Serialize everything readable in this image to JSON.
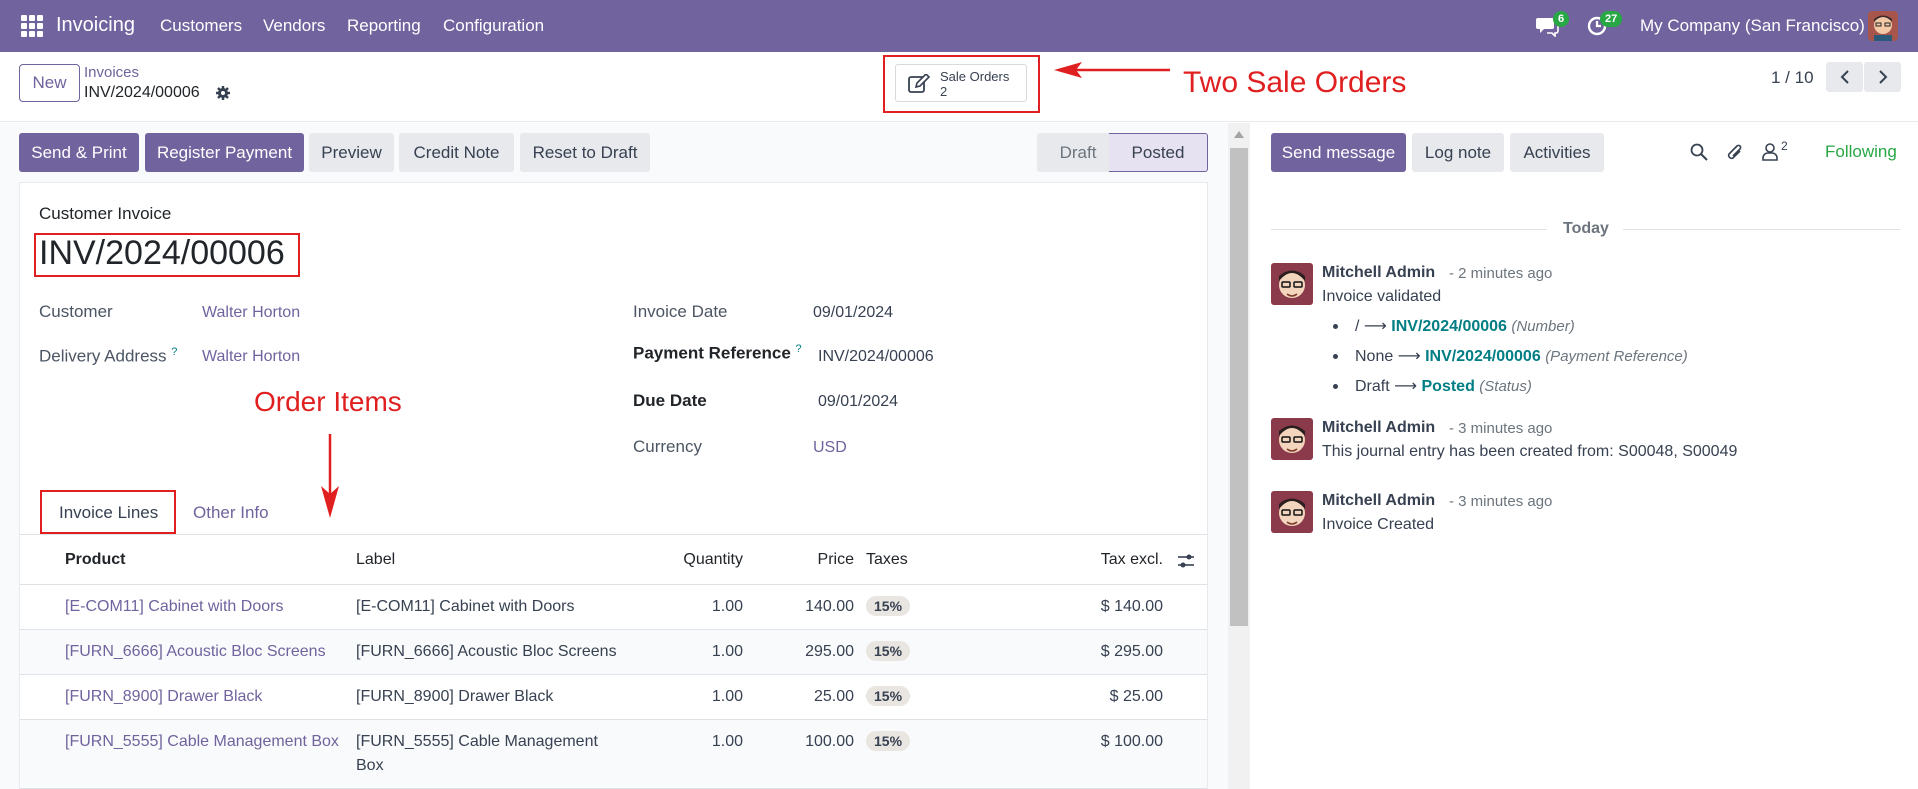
{
  "topbar": {
    "app_name": "Invoicing",
    "nav": [
      "Customers",
      "Vendors",
      "Reporting",
      "Configuration"
    ],
    "messages_count": "6",
    "activities_count": "27",
    "company": "My Company (San Francisco)"
  },
  "control": {
    "new_label": "New",
    "breadcrumb_parent": "Invoices",
    "breadcrumb_current": "INV/2024/00006",
    "smart_button_label": "Sale Orders",
    "smart_button_count": "2",
    "pager": "1 / 10"
  },
  "annotations": {
    "two_sale_orders": "Two Sale Orders",
    "order_items": "Order Items"
  },
  "actions": {
    "send_print": "Send & Print",
    "register_payment": "Register Payment",
    "preview": "Preview",
    "credit_note": "Credit Note",
    "reset_to_draft": "Reset to Draft"
  },
  "status": {
    "draft": "Draft",
    "posted": "Posted"
  },
  "form": {
    "type": "Customer Invoice",
    "number": "INV/2024/00006",
    "customer_label": "Customer",
    "customer": "Walter Horton",
    "delivery_label": "Delivery Address",
    "delivery": "Walter Horton",
    "help_mark": "?",
    "invoice_date_label": "Invoice Date",
    "invoice_date": "09/01/2024",
    "payment_ref_label": "Payment Reference",
    "payment_ref": "INV/2024/00006",
    "due_date_label": "Due Date",
    "due_date": "09/01/2024",
    "currency_label": "Currency",
    "currency": "USD"
  },
  "tabs": {
    "invoice_lines": "Invoice Lines",
    "other_info": "Other Info"
  },
  "lines": {
    "headers": {
      "product": "Product",
      "label": "Label",
      "quantity": "Quantity",
      "price": "Price",
      "taxes": "Taxes",
      "tax_excl": "Tax excl."
    },
    "rows": [
      {
        "product": "[E-COM11] Cabinet with Doors",
        "label": "[E-COM11] Cabinet with Doors",
        "label2": "",
        "quantity": "1.00",
        "price": "140.00",
        "tax": "15%",
        "subtotal": "$ 140.00"
      },
      {
        "product": "[FURN_6666] Acoustic Bloc Screens",
        "label": "[FURN_6666] Acoustic Bloc Screens",
        "label2": "",
        "quantity": "1.00",
        "price": "295.00",
        "tax": "15%",
        "subtotal": "$ 295.00"
      },
      {
        "product": "[FURN_8900] Drawer Black",
        "label": "[FURN_8900] Drawer Black",
        "label2": "",
        "quantity": "1.00",
        "price": "25.00",
        "tax": "15%",
        "subtotal": "$ 25.00"
      },
      {
        "product": "[FURN_5555] Cable Management Box",
        "label": "[FURN_5555] Cable Management",
        "label2": "Box",
        "quantity": "1.00",
        "price": "100.00",
        "tax": "15%",
        "subtotal": "$ 100.00"
      }
    ]
  },
  "chatter": {
    "send_message": "Send message",
    "log_note": "Log note",
    "activities": "Activities",
    "followers_count": "2",
    "following": "Following",
    "today": "Today",
    "messages": [
      {
        "author": "Mitchell Admin",
        "time": "- 2 minutes ago",
        "body": "Invoice validated",
        "tracking": [
          {
            "old": "/",
            "new": "INV/2024/00006",
            "field": "(Number)"
          },
          {
            "old": "None",
            "new": "INV/2024/00006",
            "field": "(Payment Reference)"
          },
          {
            "old": "Draft",
            "new": "Posted",
            "field": "(Status)"
          }
        ]
      },
      {
        "author": "Mitchell Admin",
        "time": "- 3 minutes ago",
        "body": "This journal entry has been created from: S00048, S00049"
      },
      {
        "author": "Mitchell Admin",
        "time": "- 3 minutes ago",
        "body": "Invoice Created"
      }
    ]
  },
  "colors": {
    "brand": "#71639e",
    "annotation": "#e02020",
    "link": "#017e84",
    "following": "#28a745"
  }
}
